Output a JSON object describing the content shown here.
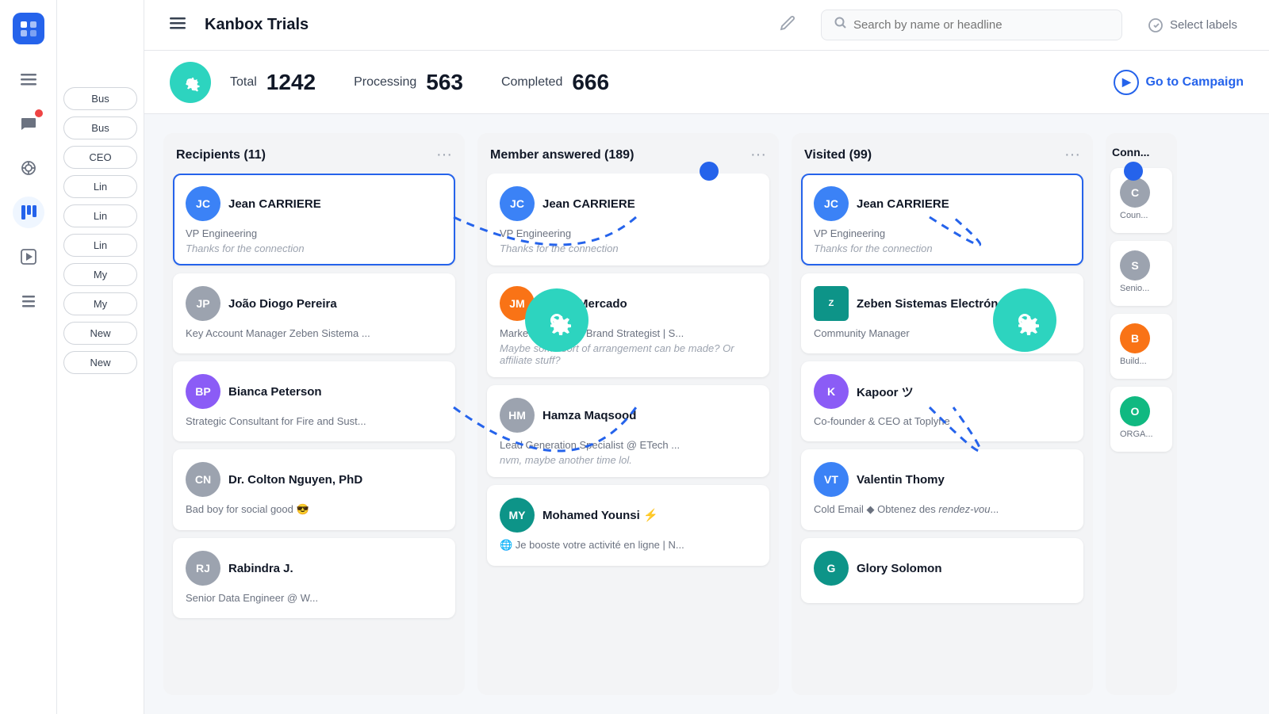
{
  "app": {
    "logo_text": "🟦",
    "title": "Kanbox Trials",
    "edit_icon": "✏️",
    "search_placeholder": "Search by name or headline",
    "label_select": "Select labels"
  },
  "stats": {
    "gear_icon": "⚙️",
    "total_label": "Total",
    "total_value": "1242",
    "processing_label": "Processing",
    "processing_value": "563",
    "completed_label": "Completed",
    "completed_value": "666",
    "go_campaign": "Go to Campaign"
  },
  "sidebar": {
    "icons": [
      "☰",
      "💬",
      "🎯",
      "📊",
      "▶",
      "📋"
    ],
    "labels": [
      "Bus",
      "Bus",
      "CEO",
      "Lin",
      "Lin",
      "Lin",
      "My",
      "My",
      "New",
      "New"
    ]
  },
  "columns": [
    {
      "id": "recipients",
      "title": "Recipients (11)",
      "cards": [
        {
          "name": "Jean CARRIERE",
          "subtitle": "VP Engineering",
          "msg": "Thanks for the connection",
          "avatar_initials": "JC",
          "avatar_color": "av-blue",
          "highlighted": true
        },
        {
          "name": "João Diogo Pereira",
          "subtitle": "Key Account Manager Zeben Sistema ...",
          "msg": "",
          "avatar_initials": "JP",
          "avatar_color": "av-gray"
        },
        {
          "name": "Bianca Peterson",
          "subtitle": "Strategic Consultant for Fire and Sust...",
          "msg": "",
          "avatar_initials": "BP",
          "avatar_color": "av-purple"
        },
        {
          "name": "Dr. Colton Nguyen, PhD",
          "subtitle": "Bad boy for social good 😎",
          "msg": "",
          "avatar_initials": "CN",
          "avatar_color": "av-gray"
        },
        {
          "name": "Rabindra J.",
          "subtitle": "Senior Data Engineer @ W...",
          "msg": "",
          "avatar_initials": "RJ",
          "avatar_color": "av-gray"
        }
      ]
    },
    {
      "id": "member-answered",
      "title": "Member answered (189)",
      "cards": [
        {
          "name": "Jean CARRIERE",
          "subtitle": "VP Engineering",
          "msg": "Thanks for the connection",
          "avatar_initials": "JC",
          "avatar_color": "av-blue",
          "highlighted": false
        },
        {
          "name": "Jorge Mercado",
          "subtitle": "Marketing Expert | Brand Strategist | S...",
          "msg": "Maybe some sort of arrangement can be made? Or affiliate stuff?",
          "avatar_initials": "JM",
          "avatar_color": "av-orange"
        },
        {
          "name": "Hamza Maqsood",
          "subtitle": "Lead Generation Specialist @ ETech ...",
          "msg": "nvm, maybe another time lol.",
          "avatar_initials": "HM",
          "avatar_color": "av-gray"
        },
        {
          "name": "Mohamed Younsi ⚡",
          "subtitle": "🌐 Je booste votre activité en ligne | N...",
          "msg": "",
          "avatar_initials": "MY",
          "avatar_color": "av-teal"
        }
      ]
    },
    {
      "id": "visited",
      "title": "Visited (99)",
      "cards": [
        {
          "name": "Jean CARRIERE",
          "subtitle": "VP Engineering",
          "msg": "Thanks for the connection",
          "avatar_initials": "JC",
          "avatar_color": "av-blue",
          "highlighted": true
        },
        {
          "name": "Zeben Sistemas Electrón...",
          "subtitle": "Community Manager",
          "msg": "",
          "avatar_initials": "Z",
          "avatar_color": "av-teal",
          "is_company": true
        },
        {
          "name": "Kapoor ツ",
          "subtitle": "Co-founder & CEO at Toplyne",
          "msg": "",
          "avatar_initials": "K",
          "avatar_color": "av-purple"
        },
        {
          "name": "Valentin Thomy",
          "subtitle": "Cold Email ◆ Obtenez des rendez-vou...",
          "msg": "",
          "avatar_initials": "VT",
          "avatar_color": "av-blue"
        },
        {
          "name": "Glory Solomon",
          "subtitle": "",
          "msg": "",
          "avatar_initials": "G",
          "avatar_color": "av-teal"
        }
      ]
    },
    {
      "id": "conn-partial",
      "title": "Conn...",
      "cards": [
        {
          "name": "",
          "subtitle": "Coun...",
          "avatar_initials": "C",
          "avatar_color": "av-gray"
        },
        {
          "name": "",
          "subtitle": "Senio...",
          "avatar_initials": "S",
          "avatar_color": "av-gray"
        },
        {
          "name": "",
          "subtitle": "Build...",
          "avatar_initials": "B",
          "avatar_color": "av-orange"
        },
        {
          "name": "",
          "subtitle": "ORGA...",
          "avatar_initials": "O",
          "avatar_color": "av-green"
        }
      ]
    }
  ]
}
